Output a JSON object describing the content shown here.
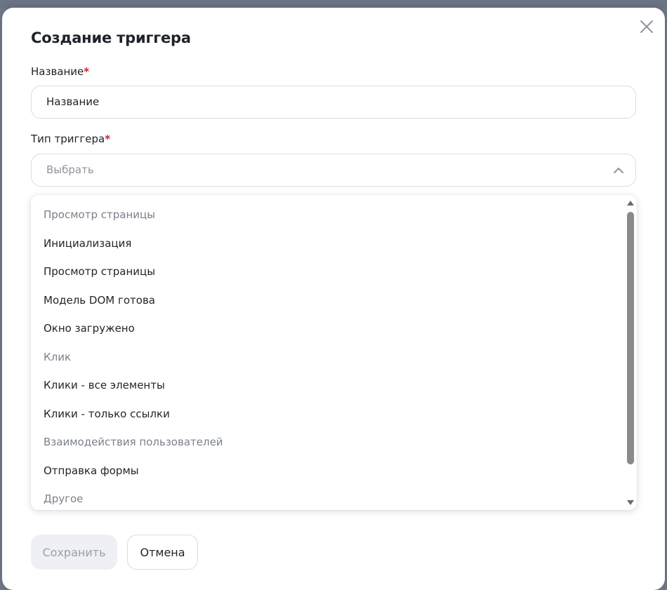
{
  "dialog": {
    "title": "Создание триггера",
    "close_icon": "close-icon"
  },
  "name_field": {
    "label": "Название",
    "required_mark": "*",
    "value": "Название"
  },
  "type_field": {
    "label": "Тип триггера",
    "required_mark": "*",
    "placeholder": "Выбрать",
    "chevron_icon": "chevron-up-icon",
    "expanded": true
  },
  "dropdown": {
    "items": [
      {
        "kind": "group",
        "label": "Просмотр страницы"
      },
      {
        "kind": "option",
        "label": "Инициализация"
      },
      {
        "kind": "option",
        "label": "Просмотр страницы"
      },
      {
        "kind": "option",
        "label": "Модель DOM готова"
      },
      {
        "kind": "option",
        "label": "Окно загружено"
      },
      {
        "kind": "group",
        "label": "Клик"
      },
      {
        "kind": "option",
        "label": "Клики - все элементы"
      },
      {
        "kind": "option",
        "label": "Клики - только ссылки"
      },
      {
        "kind": "group",
        "label": "Взаимодействия пользователей"
      },
      {
        "kind": "option",
        "label": "Отправка формы"
      },
      {
        "kind": "group",
        "label": "Другое"
      }
    ]
  },
  "buttons": {
    "save_label": "Сохранить",
    "cancel_label": "Отмена"
  },
  "colors": {
    "required": "#d01f2f",
    "text": "#1f2329",
    "muted": "#7a808a",
    "save_disabled_bg": "#eef0f4"
  }
}
